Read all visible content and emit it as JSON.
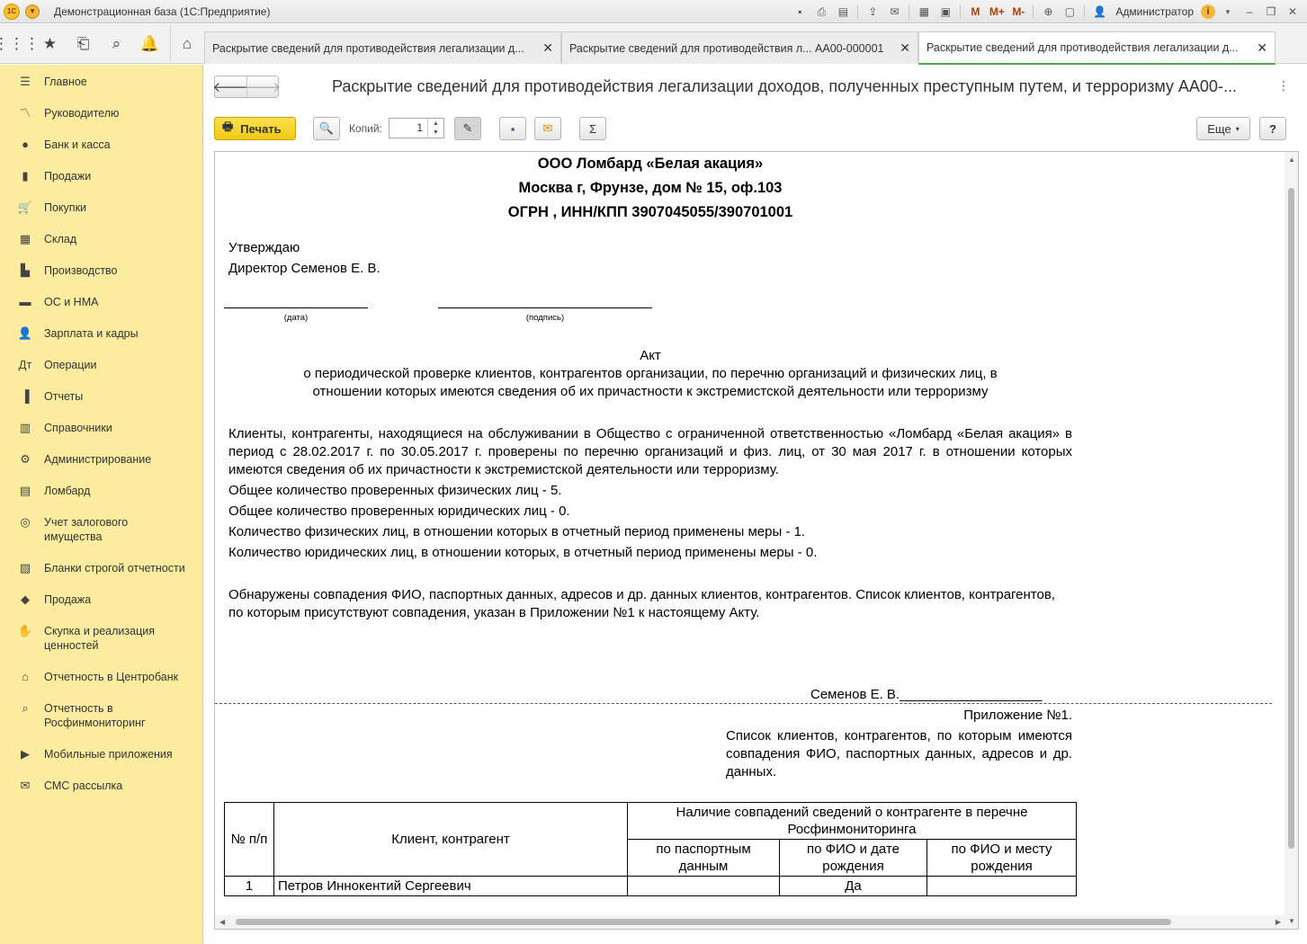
{
  "window": {
    "title": "Демонстрационная база  (1С:Предприятие)",
    "user": "Администратор"
  },
  "tabs": [
    {
      "label": "Раскрытие сведений для противодействия легализации д..."
    },
    {
      "label": "Раскрытие сведений для противодействия л...  АА00-000001"
    },
    {
      "label": "Раскрытие сведений для противодействия легализации д..."
    }
  ],
  "sidebar": {
    "items": [
      {
        "label": "Главное",
        "icon": "menu-icon"
      },
      {
        "label": "Руководителю",
        "icon": "chart-line-icon"
      },
      {
        "label": "Банк и касса",
        "icon": "coin-icon"
      },
      {
        "label": "Продажи",
        "icon": "bag-icon"
      },
      {
        "label": "Покупки",
        "icon": "cart-icon"
      },
      {
        "label": "Склад",
        "icon": "warehouse-icon"
      },
      {
        "label": "Производство",
        "icon": "factory-icon"
      },
      {
        "label": "ОС и НМА",
        "icon": "car-icon"
      },
      {
        "label": "Зарплата и кадры",
        "icon": "person-icon"
      },
      {
        "label": "Операции",
        "icon": "operations-icon"
      },
      {
        "label": "Отчеты",
        "icon": "bar-chart-icon"
      },
      {
        "label": "Справочники",
        "icon": "book-icon"
      },
      {
        "label": "Администрирование",
        "icon": "gear-icon"
      },
      {
        "label": "Ломбард",
        "icon": "document-icon"
      },
      {
        "label": "Учет залогового имущества",
        "icon": "watch-icon"
      },
      {
        "label": "Бланки строгой отчетности",
        "icon": "form-icon"
      },
      {
        "label": "Продажа",
        "icon": "tag-icon"
      },
      {
        "label": "Скупка и реализация ценностей",
        "icon": "handshake-icon"
      },
      {
        "label": "Отчетность в Центробанк",
        "icon": "bank-icon"
      },
      {
        "label": "Отчетность в Росфинмониторинг",
        "icon": "magnifier-icon"
      },
      {
        "label": "Мобильные приложения",
        "icon": "play-icon"
      },
      {
        "label": "СМС рассылка",
        "icon": "sms-icon"
      }
    ]
  },
  "main": {
    "title": "Раскрытие сведений для противодействия легализации доходов, полученных преступным путем, и терроризму АА00-...",
    "toolbar": {
      "print": "Печать",
      "copies_label": "Копий:",
      "copies_value": "1",
      "more": "Еще",
      "help": "?"
    }
  },
  "document": {
    "org_name": "ООО Ломбард «Белая акация»",
    "org_address": "Москва г, Фрунзе, дом № 15, оф.103",
    "org_ids": "ОГРН , ИНН/КПП 3907045055/390701001",
    "approve": "Утверждаю",
    "director": "Директор Семенов Е. В.",
    "date_caption": "(дата)",
    "sign_caption": "(подпись)",
    "act_title": "Акт",
    "act_line1": "о периодической проверке клиентов, контрагентов организации, по перечню организаций и физических лиц, в",
    "act_line2": "отношении которых имеются сведения об их причастности к экстремистской деятельности или терроризму",
    "para1": "Клиенты, контрагенты, находящиеся на обслуживании в Общество с ограниченной ответственностью «Ломбард «Белая акация» в период с 28.02.2017 г. по 30.05.2017 г. проверены по перечню организаций и физ. лиц, от 30 мая 2017 г. в отношении которых имеются сведения об их причастности к экстремистской деятельности или терроризму.",
    "count_phys": "Общее количество проверенных физических лиц - 5.",
    "count_legal": "Общее количество проверенных юридических лиц - 0.",
    "measures_phys": "Количество физических лиц, в отношении которых в отчетный период применены меры - 1.",
    "measures_legal": "Количество юридических лиц, в отношении которых, в отчетный период применены меры - 0.",
    "para2": "Обнаружены совпадения ФИО, паспортных данных, адресов и др. данных клиентов, контрагентов. Список клиентов, контрагентов, по которым присутствуют совпадения, указан в Приложении №1 к настоящему Акту.",
    "signature": "Семенов Е. В.___________________",
    "appendix": "Приложение №1.",
    "appendix_desc": "Список клиентов, контрагентов, по которым имеются совпадения ФИО, паспортных данных, адресов и др. данных.",
    "table": {
      "col_num": "№ п/п",
      "col_client": "Клиент, контрагент",
      "col_group": "Наличие совпадений сведений о контрагенте в перечне Росфинмониторинга",
      "col_passport": "по паспортным данным",
      "col_fio_date": "по ФИО и дате рождения",
      "col_fio_place": "по ФИО и месту рождения",
      "rows": [
        {
          "num": "1",
          "client": "Петров Иннокентий Сергеевич",
          "passport": "",
          "fio_date": "Да",
          "fio_place": ""
        }
      ]
    }
  }
}
